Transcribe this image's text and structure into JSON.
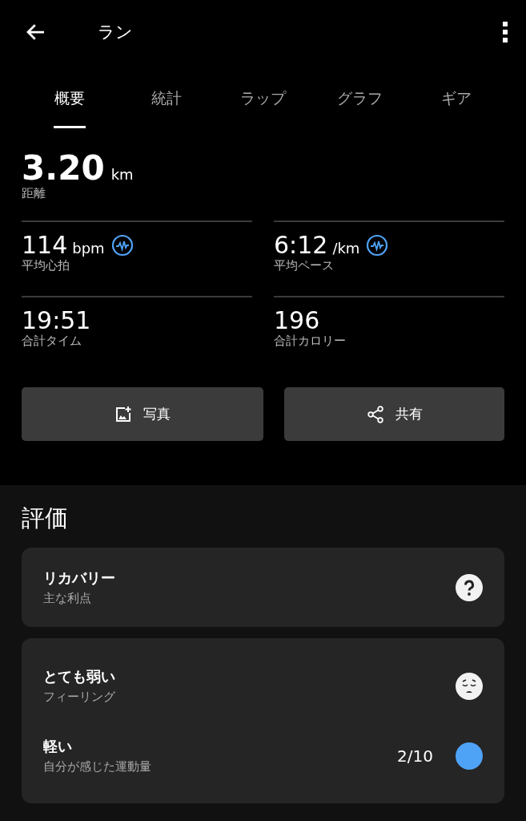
{
  "header": {
    "title": "ラン"
  },
  "tabs": [
    {
      "label": "概要",
      "selected": true
    },
    {
      "label": "統計",
      "selected": false
    },
    {
      "label": "ラップ",
      "selected": false
    },
    {
      "label": "グラフ",
      "selected": false
    },
    {
      "label": "ギア",
      "selected": false
    }
  ],
  "distance": {
    "value": "3.20",
    "unit": "km",
    "label": "距離"
  },
  "stats": [
    {
      "value": "114",
      "unit": "bpm",
      "label": "平均心拍",
      "graph_link": true
    },
    {
      "value": "6:12",
      "unit": "/km",
      "label": "平均ペース",
      "graph_link": true
    },
    {
      "value": "19:51",
      "label": "合計タイム",
      "graph_link": false
    },
    {
      "value": "196",
      "label": "合計カロリー",
      "graph_link": false
    }
  ],
  "actions": [
    {
      "kind": "photo",
      "label": "写真"
    },
    {
      "kind": "share",
      "label": "共有"
    }
  ],
  "evaluation": {
    "title": "評価",
    "cards": [
      {
        "items": [
          {
            "kind": "help",
            "title": "リカバリー",
            "subtitle": "主な利点"
          }
        ]
      },
      {
        "items": [
          {
            "kind": "face",
            "title": "とても弱い",
            "subtitle": "フィーリング"
          },
          {
            "kind": "level",
            "title": "軽い",
            "subtitle": "自分が感じた運動量",
            "reading": "2/10",
            "color": "#4fa3f7"
          }
        ]
      }
    ]
  }
}
